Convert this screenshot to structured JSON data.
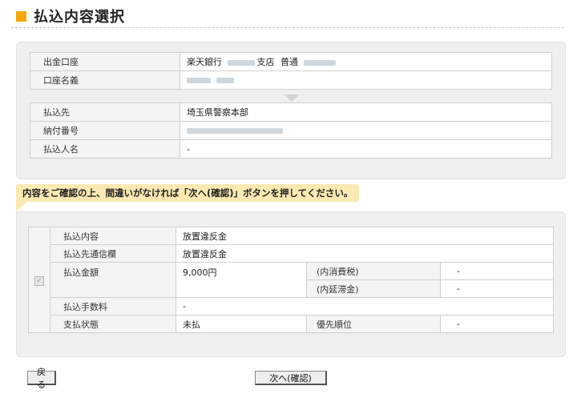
{
  "page": {
    "title": "払込内容選択"
  },
  "account": {
    "source_label": "出金口座",
    "source_bank": "楽天銀行",
    "source_branch_suffix": "支店",
    "source_type": "普通",
    "name_label": "口座名義"
  },
  "payee": {
    "to_label": "払込先",
    "to_value": "埼玉県警察本部",
    "number_label": "納付番号",
    "payer_label": "払込人名",
    "payer_value": "-"
  },
  "notice": {
    "text": "内容をご確認の上、間違いがなければ「次へ(確認)」ボタンを押してください。"
  },
  "details": {
    "content_label": "払込内容",
    "content_value": "放置違反金",
    "memo_label": "払込先通信欄",
    "memo_value": "放置違反金",
    "amount_label": "払込金額",
    "amount_value": "9,000円",
    "tax_label": "(内消費税)",
    "tax_value": "-",
    "late_label": "(内延滞金)",
    "late_value": "-",
    "fee_label": "払込手数料",
    "fee_value": "-",
    "status_label": "支払状態",
    "status_value": "未払",
    "priority_label": "優先順位",
    "priority_value": "-"
  },
  "buttons": {
    "back": "戻る",
    "next": "次へ(確認)"
  },
  "colors": {
    "title_accent": "#f7a70c",
    "notice_bg": "#fbe9b3",
    "panel_bg": "#efefef"
  }
}
